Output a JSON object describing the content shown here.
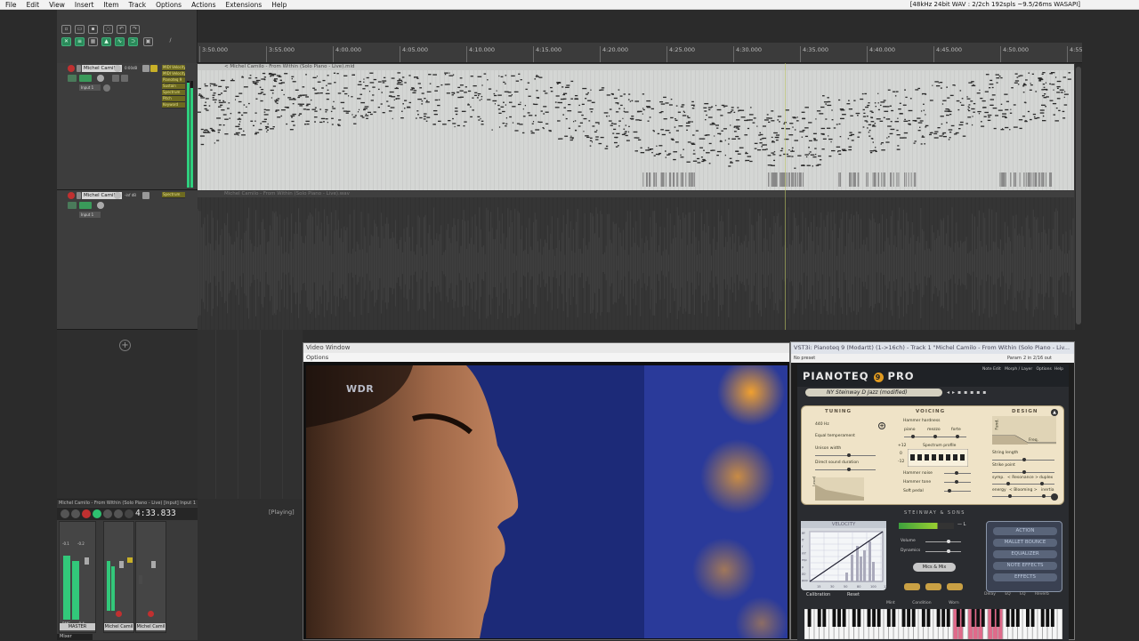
{
  "menu": [
    "File",
    "Edit",
    "View",
    "Insert",
    "Item",
    "Track",
    "Options",
    "Actions",
    "Extensions",
    "Help"
  ],
  "audio_info": "[48kHz 24bit WAV : 2/2ch 192spls ~9.5/26ms WASAPI]",
  "ruler": [
    "3:50.000",
    "3:55.000",
    "4:00.000",
    "4:05.000",
    "4:10.000",
    "4:15.000",
    "4:20.000",
    "4:25.000",
    "4:30.000",
    "4:35.000",
    "4:40.000",
    "4:45.000",
    "4:50.000",
    "4:55"
  ],
  "tracks": [
    {
      "name": "Michel Camilo",
      "time": "0:00dB",
      "lanes": [
        "MIDI Velocity",
        "MIDI Velocity",
        "Pianoteq 9",
        "Sustain",
        "Spectrum",
        "Pitch",
        "Keyword"
      ]
    },
    {
      "name": "Michel Camilo",
      "time": "-inf dB",
      "lanes": [
        "Spectrum"
      ]
    }
  ],
  "items": {
    "midi": "< Michel Camilo - From Within (Solo Piano - Live).mid",
    "audio": "Michel Camilo - From Within (Solo Piano - Live).wav"
  },
  "input_labels": [
    "Input 1",
    "Input 1"
  ],
  "mixer": {
    "title": "Michel Camilo - From Within (Solo Piano - Live) [input] Input 1",
    "timecode": "4:33.833",
    "master_label": "MASTER",
    "strip_labels": [
      "Michel Camil",
      "Michel Camil"
    ],
    "tab": "Mixer",
    "master_db": [
      "-0.1",
      "-0.2",
      "RMS",
      "-0.4"
    ]
  },
  "status": "[Playing]",
  "video": {
    "title": "Video Window",
    "options": "Options",
    "logo": "WDR"
  },
  "plugin": {
    "title": "VST3i: Pianoteq 9 (Modartt) (1->16ch) - Track 1 \"Michel Camilo - From Within (Solo Piano - Liv...",
    "preset_field": "No preset",
    "param_btn": "Param",
    "io_btn": "2 in 2/16 out",
    "logo": "PIANOTEQ",
    "edition": "9",
    "edition_suffix": "PRO",
    "menu": [
      "Note Edit",
      "Morph / Layer",
      "Options",
      "Help"
    ],
    "preset": "NY Steinway D Jazz (modified)",
    "sections": [
      "TUNING",
      "VOICING",
      "DESIGN"
    ],
    "tuning": [
      "440 Hz",
      "Equal temperament",
      "Unison width",
      "Direct sound duration",
      "Level",
      "Time"
    ],
    "voicing": [
      "Hammer hardness",
      "piano",
      "mezzo",
      "forte",
      "Spectrum profile",
      "Hammer noise",
      "Hammer tone",
      "Soft pedal"
    ],
    "spectrum_scale": [
      "+12",
      "0",
      "-12"
    ],
    "design": [
      "String length",
      "Strike point",
      "symp.",
      "< Resonance >",
      "duplex",
      "energy",
      "< Blooming >",
      "inertia",
      "Fund.",
      "Freq."
    ],
    "brand": "STEINWAY & SONS",
    "velocity": "VELOCITY",
    "velo_axis": [
      "ppp",
      "pp",
      "p",
      "mp",
      "mf",
      "f",
      "ff",
      "fff"
    ],
    "velo_x": [
      "15",
      "30",
      "50",
      "80",
      "100",
      "127"
    ],
    "volume": "Volume",
    "dynamics": "Dynamics",
    "mics": "Mics & Mix",
    "calibration": "Calibration",
    "reset": "Reset",
    "buttons": [
      "ACTION",
      "MALLET BOUNCE",
      "EQUALIZER",
      "NOTE EFFECTS",
      "EFFECTS"
    ],
    "bottom_buttons": [
      "Delay",
      "EQ",
      "EQ",
      "Reverb"
    ],
    "conditions": [
      "Mint",
      "Condition",
      "Worn"
    ]
  }
}
